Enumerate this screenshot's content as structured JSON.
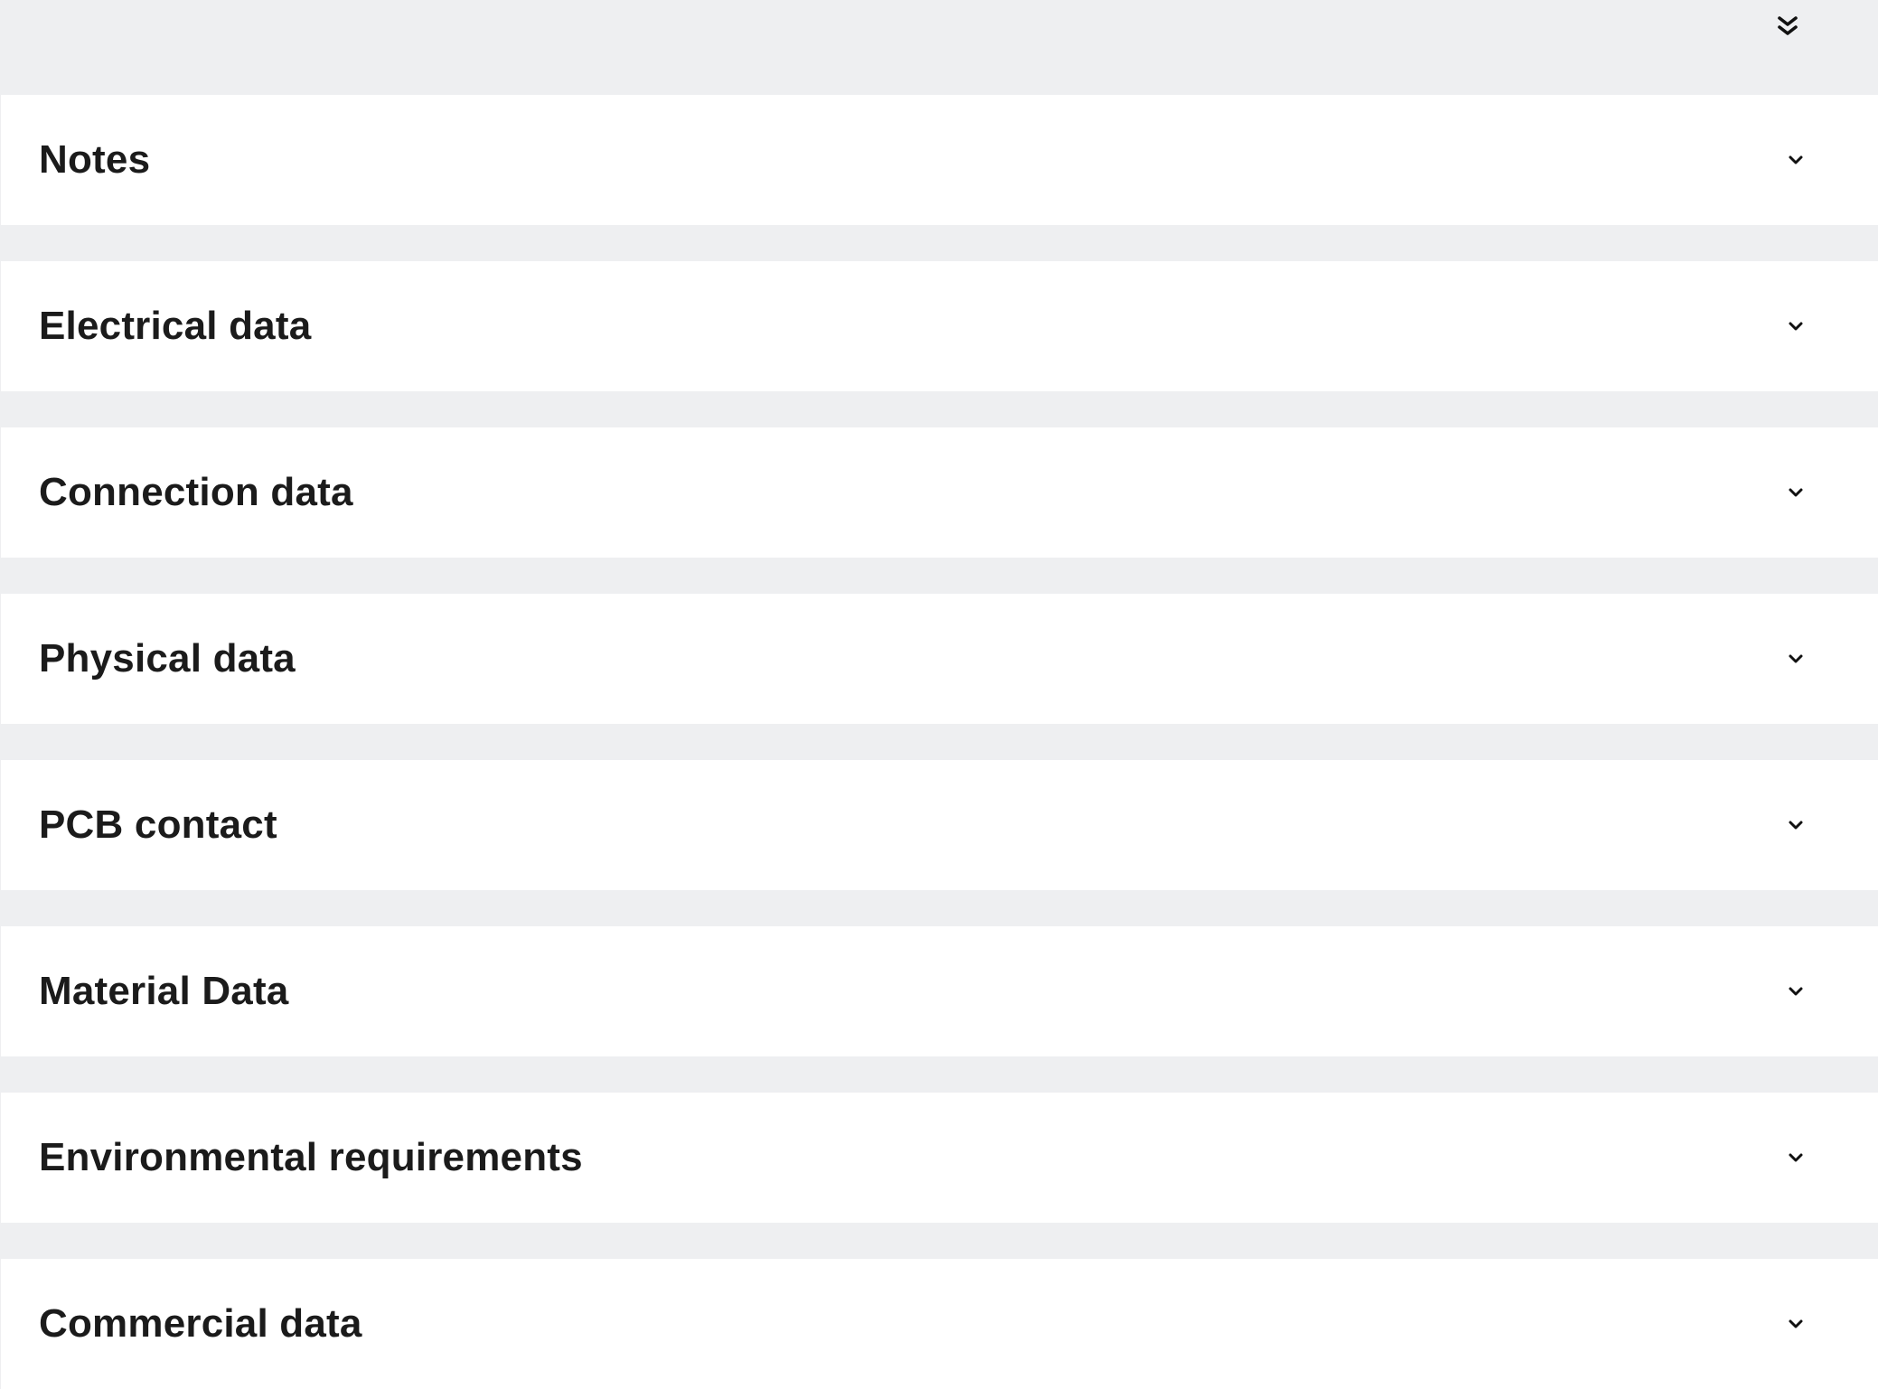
{
  "toolbar": {
    "expand_all_icon": "double-chevron-down-icon"
  },
  "sections": [
    {
      "label": "Notes",
      "icon": "chevron-down-icon"
    },
    {
      "label": "Electrical data",
      "icon": "chevron-down-icon"
    },
    {
      "label": "Connection data",
      "icon": "chevron-down-icon"
    },
    {
      "label": "Physical data",
      "icon": "chevron-down-icon"
    },
    {
      "label": "PCB contact",
      "icon": "chevron-down-icon"
    },
    {
      "label": "Material Data",
      "icon": "chevron-down-icon"
    },
    {
      "label": "Environmental requirements",
      "icon": "chevron-down-icon"
    },
    {
      "label": "Commercial data",
      "icon": "chevron-down-icon"
    }
  ],
  "colors": {
    "background": "#eeeff1",
    "panel": "#ffffff",
    "text": "#1b1b1b"
  }
}
